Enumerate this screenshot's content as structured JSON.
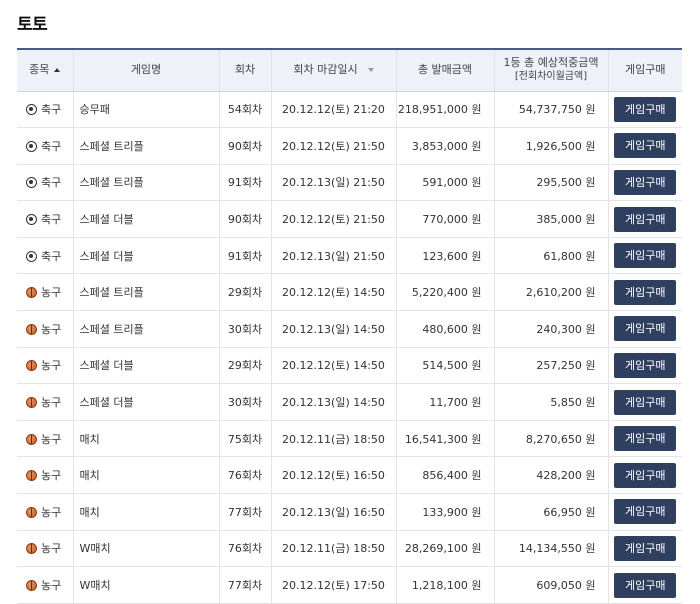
{
  "page": {
    "title": "토토"
  },
  "headers": {
    "sport": "종목",
    "game_name": "게임명",
    "round": "회차",
    "deadline": "회차 마감일시",
    "total_sales": "총 발매금액",
    "expected_line1": "1등 총 예상적중금액",
    "expected_line2": "[전회차이월금액]",
    "purchase": "게임구매"
  },
  "rows": [
    {
      "sport": "축구",
      "sport_icon": "soccer-ball-icon",
      "game": "승무패",
      "round": "54회차",
      "deadline": "20.12.12(토) 21:20",
      "sales": "218,951,000 원",
      "expected": "54,737,750 원",
      "button": "게임구매"
    },
    {
      "sport": "축구",
      "sport_icon": "soccer-ball-icon",
      "game": "스페셜 트리플",
      "round": "90회차",
      "deadline": "20.12.12(토) 21:50",
      "sales": "3,853,000 원",
      "expected": "1,926,500 원",
      "button": "게임구매"
    },
    {
      "sport": "축구",
      "sport_icon": "soccer-ball-icon",
      "game": "스페셜 트리플",
      "round": "91회차",
      "deadline": "20.12.13(일) 21:50",
      "sales": "591,000 원",
      "expected": "295,500 원",
      "button": "게임구매"
    },
    {
      "sport": "축구",
      "sport_icon": "soccer-ball-icon",
      "game": "스페셜 더블",
      "round": "90회차",
      "deadline": "20.12.12(토) 21:50",
      "sales": "770,000 원",
      "expected": "385,000 원",
      "button": "게임구매"
    },
    {
      "sport": "축구",
      "sport_icon": "soccer-ball-icon",
      "game": "스페셜 더블",
      "round": "91회차",
      "deadline": "20.12.13(일) 21:50",
      "sales": "123,600 원",
      "expected": "61,800 원",
      "button": "게임구매"
    },
    {
      "sport": "농구",
      "sport_icon": "basketball-icon",
      "game": "스페셜 트리플",
      "round": "29회차",
      "deadline": "20.12.12(토) 14:50",
      "sales": "5,220,400 원",
      "expected": "2,610,200 원",
      "button": "게임구매"
    },
    {
      "sport": "농구",
      "sport_icon": "basketball-icon",
      "game": "스페셜 트리플",
      "round": "30회차",
      "deadline": "20.12.13(일) 14:50",
      "sales": "480,600 원",
      "expected": "240,300 원",
      "button": "게임구매"
    },
    {
      "sport": "농구",
      "sport_icon": "basketball-icon",
      "game": "스페셜 더블",
      "round": "29회차",
      "deadline": "20.12.12(토) 14:50",
      "sales": "514,500 원",
      "expected": "257,250 원",
      "button": "게임구매"
    },
    {
      "sport": "농구",
      "sport_icon": "basketball-icon",
      "game": "스페셜 더블",
      "round": "30회차",
      "deadline": "20.12.13(일) 14:50",
      "sales": "11,700 원",
      "expected": "5,850 원",
      "button": "게임구매"
    },
    {
      "sport": "농구",
      "sport_icon": "basketball-icon",
      "game": "매치",
      "round": "75회차",
      "deadline": "20.12.11(금) 18:50",
      "sales": "16,541,300 원",
      "expected": "8,270,650 원",
      "button": "게임구매"
    },
    {
      "sport": "농구",
      "sport_icon": "basketball-icon",
      "game": "매치",
      "round": "76회차",
      "deadline": "20.12.12(토) 16:50",
      "sales": "856,400 원",
      "expected": "428,200 원",
      "button": "게임구매"
    },
    {
      "sport": "농구",
      "sport_icon": "basketball-icon",
      "game": "매치",
      "round": "77회차",
      "deadline": "20.12.13(일) 16:50",
      "sales": "133,900 원",
      "expected": "66,950 원",
      "button": "게임구매"
    },
    {
      "sport": "농구",
      "sport_icon": "basketball-icon",
      "game": "W매치",
      "round": "76회차",
      "deadline": "20.12.11(금) 18:50",
      "sales": "28,269,100 원",
      "expected": "14,134,550 원",
      "button": "게임구매"
    },
    {
      "sport": "농구",
      "sport_icon": "basketball-icon",
      "game": "W매치",
      "round": "77회차",
      "deadline": "20.12.12(토) 17:50",
      "sales": "1,218,100 원",
      "expected": "609,050 원",
      "button": "게임구매"
    }
  ]
}
